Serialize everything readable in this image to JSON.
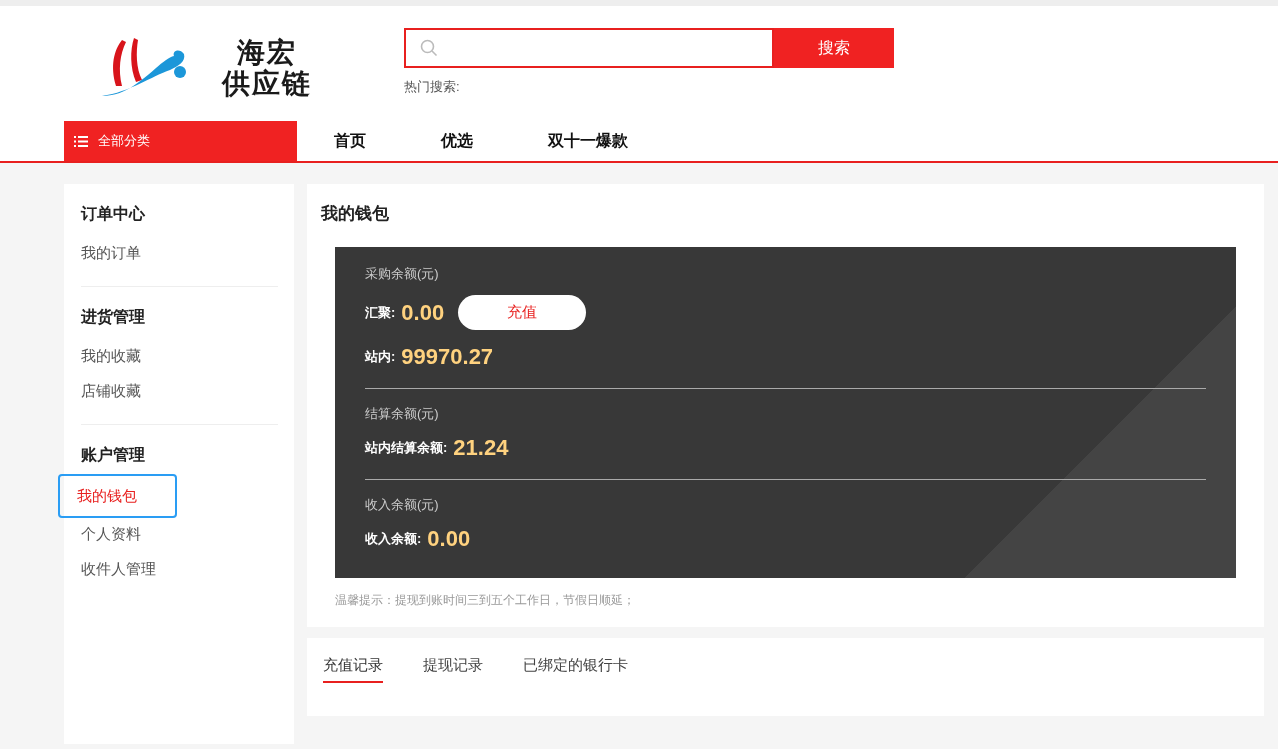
{
  "header": {
    "logo": {
      "lines": [
        "海宏",
        "供应链"
      ]
    },
    "search": {
      "button": "搜索",
      "hot_label": "热门搜索:"
    }
  },
  "nav": {
    "categories": "全部分类",
    "items": [
      {
        "label": "首页"
      },
      {
        "label": "优选"
      },
      {
        "label": "双十一爆款"
      }
    ]
  },
  "sidebar": {
    "groups": [
      {
        "title": "订单中心",
        "items": [
          {
            "label": "我的订单",
            "selected": false
          }
        ]
      },
      {
        "title": "进货管理",
        "items": [
          {
            "label": "我的收藏",
            "selected": false
          },
          {
            "label": "店铺收藏",
            "selected": false
          }
        ]
      },
      {
        "title": "账户管理",
        "items": [
          {
            "label": "我的钱包",
            "selected": true
          },
          {
            "label": "个人资料",
            "selected": false
          },
          {
            "label": "收件人管理",
            "selected": false
          }
        ]
      }
    ]
  },
  "wallet": {
    "title": "我的钱包",
    "sections": [
      {
        "heading": "采购余额(元)",
        "rows": [
          {
            "label": "汇聚:",
            "amount": "0.00",
            "button": "充值"
          },
          {
            "label": "站内:",
            "amount": "99970.27"
          }
        ]
      },
      {
        "heading": "结算余额(元)",
        "rows": [
          {
            "label": "站内结算余额:",
            "amount": "21.24"
          }
        ]
      },
      {
        "heading": "收入余额(元)",
        "rows": [
          {
            "label": "收入余额:",
            "amount": "0.00"
          }
        ]
      }
    ],
    "notice": "温馨提示：提现到账时间三到五个工作日，节假日顺延；"
  },
  "records": {
    "tabs": [
      {
        "label": "充值记录",
        "selected": true
      },
      {
        "label": "提现记录",
        "selected": false
      },
      {
        "label": "已绑定的银行卡",
        "selected": false
      }
    ]
  }
}
